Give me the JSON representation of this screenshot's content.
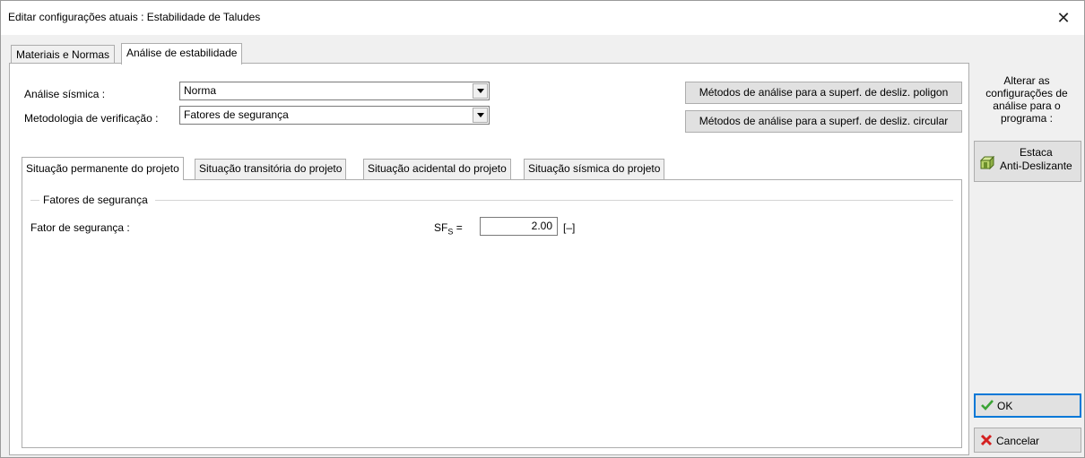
{
  "window": {
    "title": "Editar configurações atuais : Estabilidade de Taludes",
    "close_glyph": "✕"
  },
  "tabs": [
    {
      "label": "Materiais e Normas"
    },
    {
      "label": "Análise de estabilidade"
    }
  ],
  "form": {
    "seismic_label": "Análise sísmica :",
    "seismic_value": "Norma",
    "methodology_label": "Metodologia de verificação :",
    "methodology_value": "Fatores de segurança"
  },
  "buttons": {
    "polygon_methods": "Métodos de análise para a superf. de desliz. poligon",
    "circular_methods": "Métodos de análise para a superf. de desliz. circular"
  },
  "subtabs": [
    {
      "label": "Situação permanente do projeto"
    },
    {
      "label": "Situação transitória do projeto"
    },
    {
      "label": "Situação acidental do projeto"
    },
    {
      "label": "Situação sísmica do projeto"
    }
  ],
  "group": {
    "title": "Fatores de segurança",
    "safety_factor_label": "Fator de segurança :",
    "sf_symbol": "SF",
    "sf_subscript": "S",
    "sf_equals": " =",
    "sf_value": "2.00",
    "sf_unit": "[–]"
  },
  "sidebar": {
    "caption_lines": [
      "Alterar as",
      "configurações de",
      "análise para o",
      "programa :"
    ],
    "program_button_lines": [
      "Estaca",
      "Anti-Deslizante"
    ],
    "ok_label": "OK",
    "cancel_label": "Cancelar"
  },
  "colors": {
    "ok_check": "#3aa335",
    "cancel_x": "#d42020",
    "ok_border": "#0078d7"
  }
}
